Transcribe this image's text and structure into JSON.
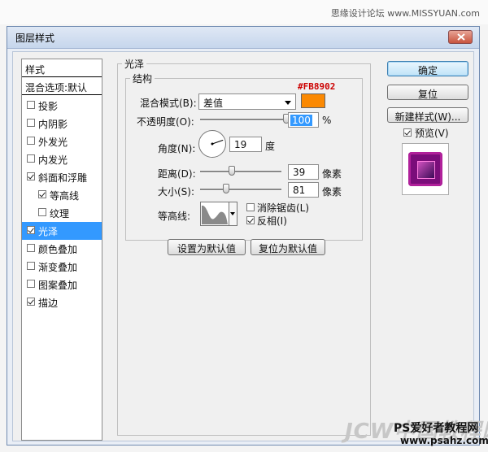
{
  "watermark_top": "思缘设计论坛 www.MISSYUAN.com",
  "dialog": {
    "title": "图层样式"
  },
  "styles_list": {
    "header": "样式",
    "blend_options": "混合选项:默认",
    "items": [
      {
        "label": "投影",
        "checked": false,
        "indent": false
      },
      {
        "label": "内阴影",
        "checked": false,
        "indent": false
      },
      {
        "label": "外发光",
        "checked": false,
        "indent": false
      },
      {
        "label": "内发光",
        "checked": false,
        "indent": false
      },
      {
        "label": "斜面和浮雕",
        "checked": true,
        "indent": false
      },
      {
        "label": "等高线",
        "checked": true,
        "indent": true
      },
      {
        "label": "纹理",
        "checked": false,
        "indent": true
      },
      {
        "label": "光泽",
        "checked": true,
        "indent": false,
        "selected": true
      },
      {
        "label": "颜色叠加",
        "checked": false,
        "indent": false
      },
      {
        "label": "渐变叠加",
        "checked": false,
        "indent": false
      },
      {
        "label": "图案叠加",
        "checked": false,
        "indent": false
      },
      {
        "label": "描边",
        "checked": true,
        "indent": false
      }
    ]
  },
  "panel": {
    "group_title": "光泽",
    "structure_title": "结构",
    "color_hex_label": "#FB8902",
    "color": "#FB8902",
    "blend_mode_label": "混合模式(B):",
    "blend_mode_value": "差值",
    "opacity_label": "不透明度(O):",
    "opacity_value": "100",
    "opacity_unit": "%",
    "opacity_level": 1.0,
    "angle_label": "角度(N):",
    "angle_value": "19",
    "angle_unit": "度",
    "distance_label": "距离(D):",
    "distance_value": "39",
    "distance_unit": "像素",
    "distance_level": 0.39,
    "size_label": "大小(S):",
    "size_value": "81",
    "size_unit": "像素",
    "size_level": 0.32,
    "contour_label": "等高线:",
    "antialias_label": "消除锯齿(L)",
    "antialias_checked": false,
    "invert_label": "反相(I)",
    "invert_checked": true,
    "set_default": "设置为默认值",
    "reset_default": "复位为默认值"
  },
  "buttons": {
    "ok": "确定",
    "reset": "复位",
    "new_style": "新建样式(W)...",
    "preview_label": "预览(V)",
    "preview_checked": true
  },
  "watermark_bottom": "JCW中国教程网",
  "watermark_ps": "PS爱好者教程网",
  "watermark_ps_url": "www.psahz.com"
}
